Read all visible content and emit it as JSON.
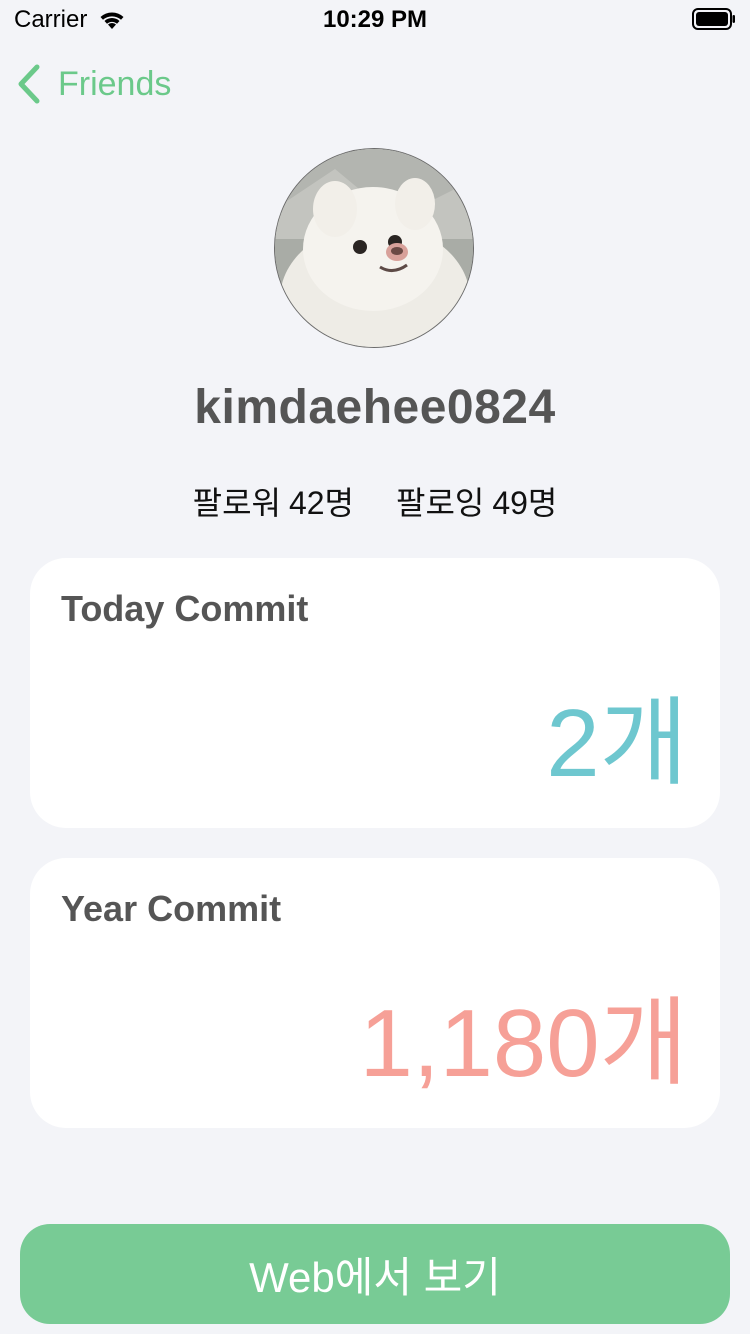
{
  "status_bar": {
    "carrier": "Carrier",
    "time": "10:29 PM"
  },
  "nav": {
    "back_label": "Friends",
    "accent_color": "#6bc98a"
  },
  "profile": {
    "username": "kimdaehee0824",
    "followers": {
      "label": "팔로워",
      "count": "42명"
    },
    "following": {
      "label": "팔로잉",
      "count": "49명"
    }
  },
  "stats": {
    "today": {
      "title": "Today Commit",
      "value": "2개",
      "color": "#6ec7cf"
    },
    "year": {
      "title": "Year Commit",
      "value": "1,180개",
      "color": "#f6a097"
    }
  },
  "action": {
    "web_button_label": "Web에서 보기",
    "color": "#78cb95"
  }
}
